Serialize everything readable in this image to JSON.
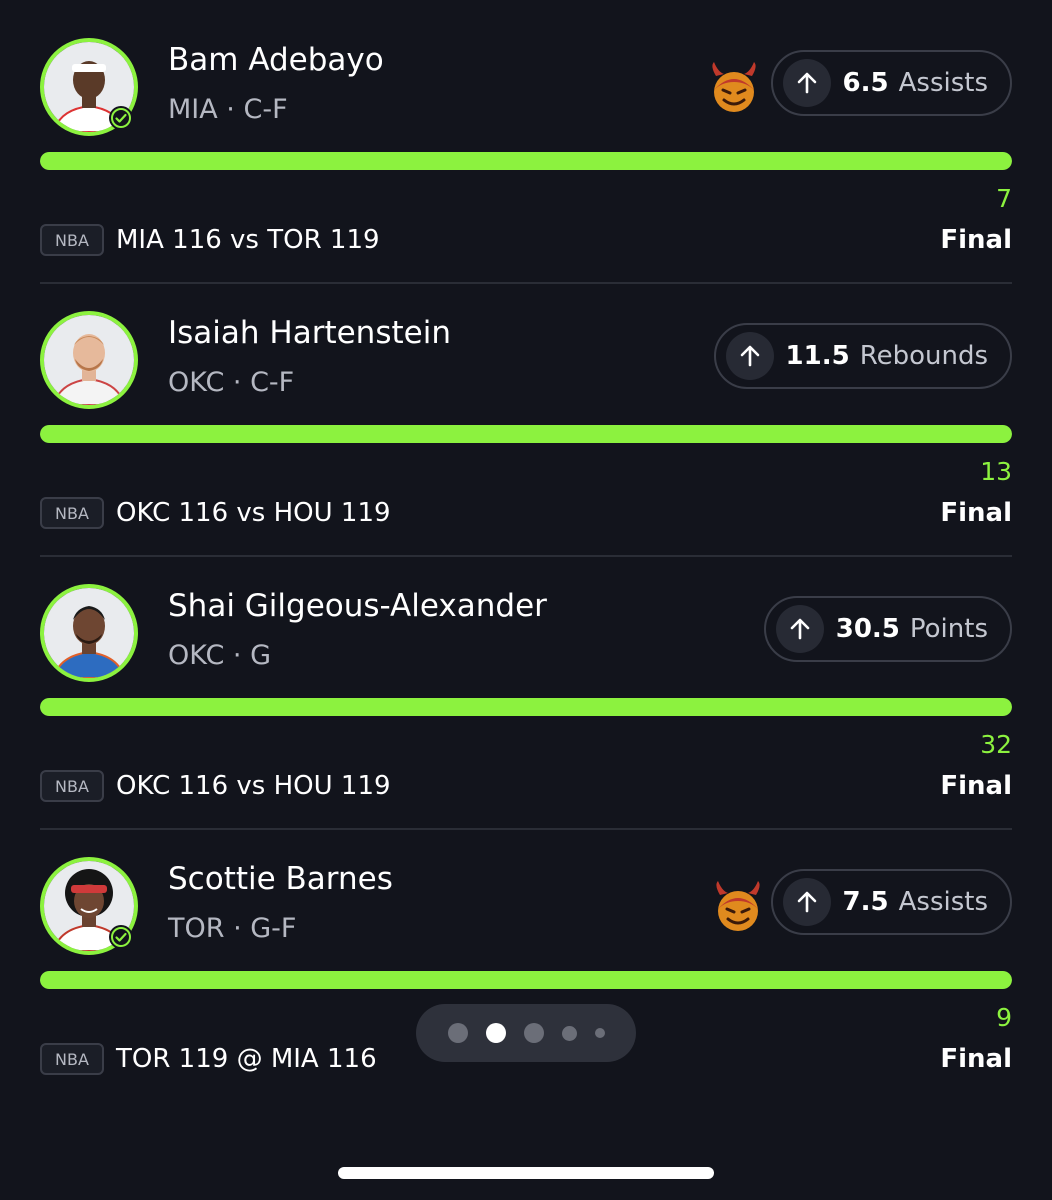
{
  "colors": {
    "accent": "#8cf23f",
    "background": "#12141c",
    "muted_text": "#b5b8c2"
  },
  "picks": [
    {
      "player": "Bam Adebayo",
      "meta": "MIA · C-F",
      "line": "6.5",
      "stat": "Assists",
      "direction_icon": "arrow-up-icon",
      "demon": true,
      "verified": true,
      "actual": "7",
      "progress_fraction": 1.0,
      "league": "NBA",
      "matchup": "MIA 116 vs TOR 119",
      "status": "Final"
    },
    {
      "player": "Isaiah Hartenstein",
      "meta": "OKC · C-F",
      "line": "11.5",
      "stat": "Rebounds",
      "direction_icon": "arrow-up-icon",
      "demon": false,
      "verified": false,
      "actual": "13",
      "progress_fraction": 1.0,
      "league": "NBA",
      "matchup": "OKC 116 vs HOU 119",
      "status": "Final"
    },
    {
      "player": "Shai Gilgeous-Alexander",
      "meta": "OKC · G",
      "line": "30.5",
      "stat": "Points",
      "direction_icon": "arrow-up-icon",
      "demon": false,
      "verified": false,
      "actual": "32",
      "progress_fraction": 1.0,
      "league": "NBA",
      "matchup": "OKC 116 vs HOU 119",
      "status": "Final"
    },
    {
      "player": "Scottie Barnes",
      "meta": "TOR · G-F",
      "line": "7.5",
      "stat": "Assists",
      "direction_icon": "arrow-up-icon",
      "demon": true,
      "verified": true,
      "actual": "9",
      "progress_fraction": 1.0,
      "league": "NBA",
      "matchup": "TOR 119 @ MIA 116",
      "status": "Final"
    }
  ],
  "pager": {
    "page_count": 5,
    "active_index": 1
  }
}
